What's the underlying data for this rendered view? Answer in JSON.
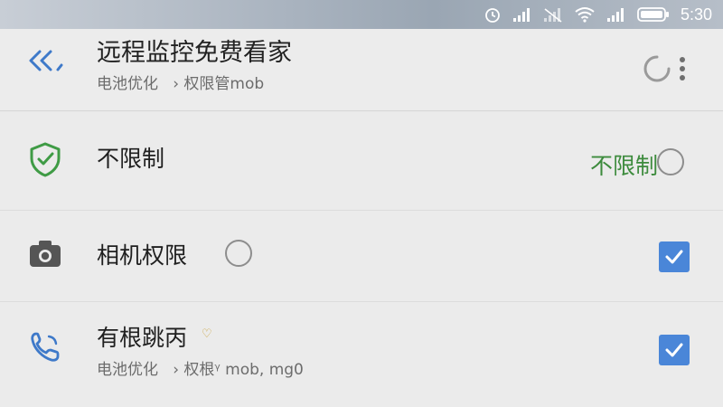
{
  "status_bar": {
    "time": "5:30",
    "icons": [
      "alarm-icon",
      "signal-icon",
      "no-sim-signal-icon",
      "wifi-icon",
      "signal-icon",
      "battery-icon"
    ]
  },
  "header": {
    "title": "远程监控免费看家",
    "breadcrumb": "电池优化   › 权限管mob",
    "back_icon": "double-chevron-left-icon",
    "menu_icon": "more-vertical-icon"
  },
  "rows": [
    {
      "icon": "shield-check-icon",
      "title": "不限制",
      "status_text": "不限制",
      "control": "radio",
      "selected": false
    },
    {
      "icon": "camera-icon",
      "title": "相机权限",
      "control": "checkbox",
      "checked": true
    },
    {
      "icon": "phone-icon",
      "title": "有根跳丙",
      "badge_icon": "heart-icon",
      "subtitle": "电池优化   › 权根ᵞ mob, mg0",
      "control": "checkbox",
      "checked": true
    }
  ],
  "colors": {
    "accent_blue": "#4a86d8",
    "shield_green": "#3f9b45",
    "status_green": "#3d8b3d",
    "back_blue": "#3e79c9"
  }
}
